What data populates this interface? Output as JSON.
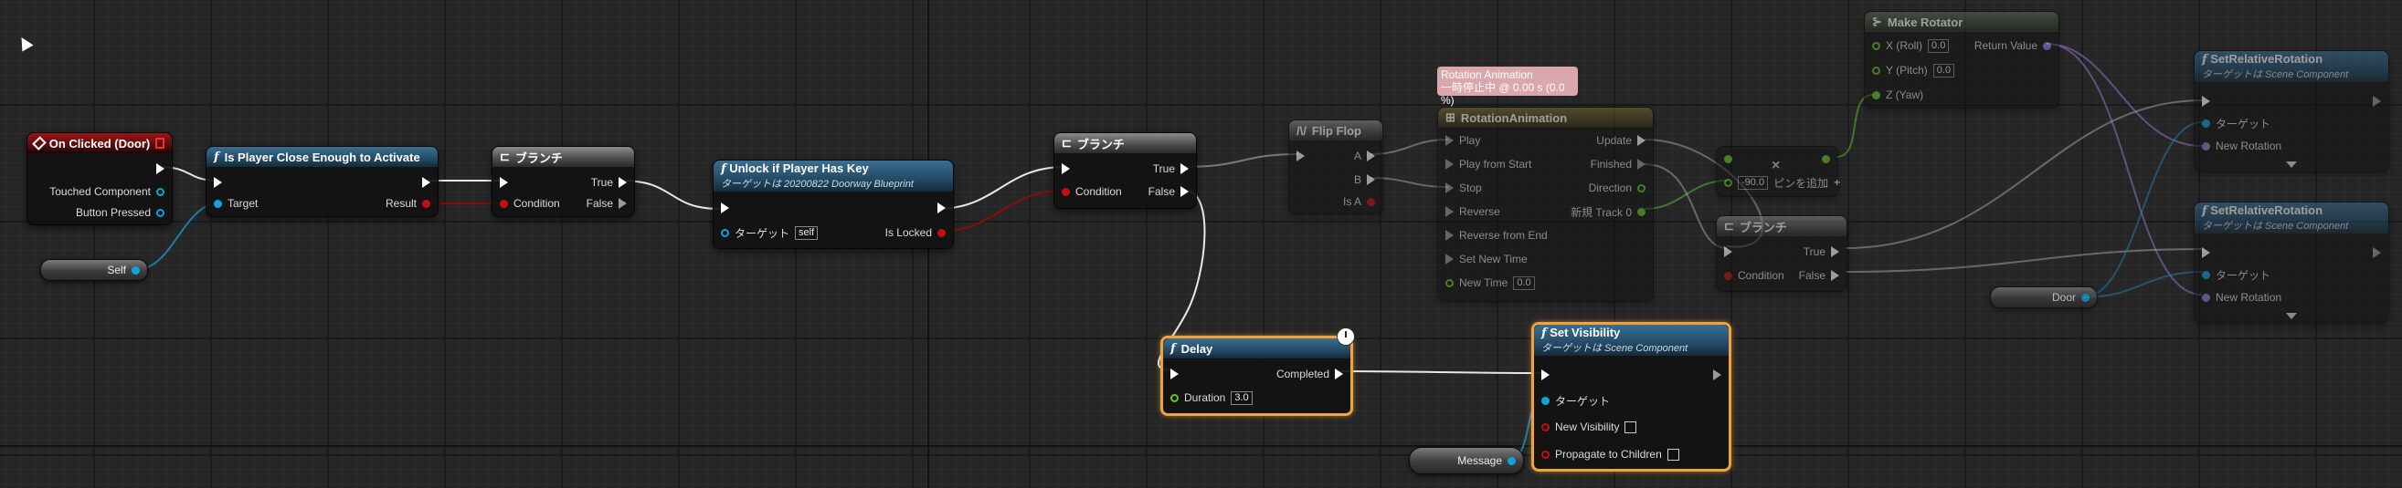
{
  "nodes": {
    "on_clicked": {
      "title": "On Clicked (Door)",
      "pins": [
        "Touched Component",
        "Button Pressed"
      ]
    },
    "self_var": {
      "label": "Self"
    },
    "is_player_close": {
      "title": "Is Player Close Enough to Activate",
      "target": "Target",
      "result": "Result"
    },
    "branch1": {
      "title": "ブランチ",
      "true": "True",
      "false": "False",
      "condition": "Condition"
    },
    "unlock": {
      "title": "Unlock if Player Has Key",
      "subtitle": "ターゲットは 20200822 Doorway Blueprint",
      "target": "ターゲット",
      "self_value": "self",
      "is_locked": "Is Locked"
    },
    "branch2": {
      "title": "ブランチ",
      "true": "True",
      "false": "False",
      "condition": "Condition"
    },
    "flipflop": {
      "title": "Flip Flop",
      "a": "A",
      "b": "B",
      "is_a": "Is A"
    },
    "rot_comment": {
      "line1": "Rotation Animation",
      "line2": "一時停止中 @ 0.00 s (0.0 %)"
    },
    "rotation_anim": {
      "title": "RotationAnimation",
      "inputs": [
        "Play",
        "Play from Start",
        "Stop",
        "Reverse",
        "Reverse from End",
        "Set New Time"
      ],
      "new_time_label": "New Time",
      "new_time_value": "0.0",
      "outputs": [
        "Update",
        "Finished",
        "Direction",
        "新規 Track 0"
      ]
    },
    "reroute": {
      "value": "-90.0",
      "add_label": "ピンを追加"
    },
    "make_rotator": {
      "title": "Make Rotator",
      "x_label": "X (Roll)",
      "x_value": "0.0",
      "y_label": "Y (Pitch)",
      "y_value": "0.0",
      "z_label": "Z (Yaw)",
      "return_label": "Return Value"
    },
    "branch3": {
      "title": "ブランチ",
      "true": "True",
      "false": "False",
      "condition": "Condition"
    },
    "door_var": {
      "label": "Door"
    },
    "set_rel_rot1": {
      "title": "SetRelativeRotation",
      "subtitle": "ターゲットは Scene Component",
      "target": "ターゲット",
      "new_rotation": "New Rotation"
    },
    "set_rel_rot2": {
      "title": "SetRelativeRotation",
      "subtitle": "ターゲットは Scene Component",
      "target": "ターゲット",
      "new_rotation": "New Rotation"
    },
    "delay": {
      "title": "Delay",
      "completed": "Completed",
      "duration_label": "Duration",
      "duration_value": "3.0"
    },
    "set_visibility": {
      "title": "Set Visibility",
      "subtitle": "ターゲットは Scene Component",
      "target": "ターゲット",
      "new_visibility": "New Visibility",
      "propagate": "Propagate to Children"
    },
    "message_var": {
      "label": "Message"
    }
  },
  "colors": {
    "exec_wire": "#ffffff",
    "bool_wire": "#8a0d0d",
    "object_wire": "#0fa3d8",
    "selection": "#f2a23a"
  }
}
